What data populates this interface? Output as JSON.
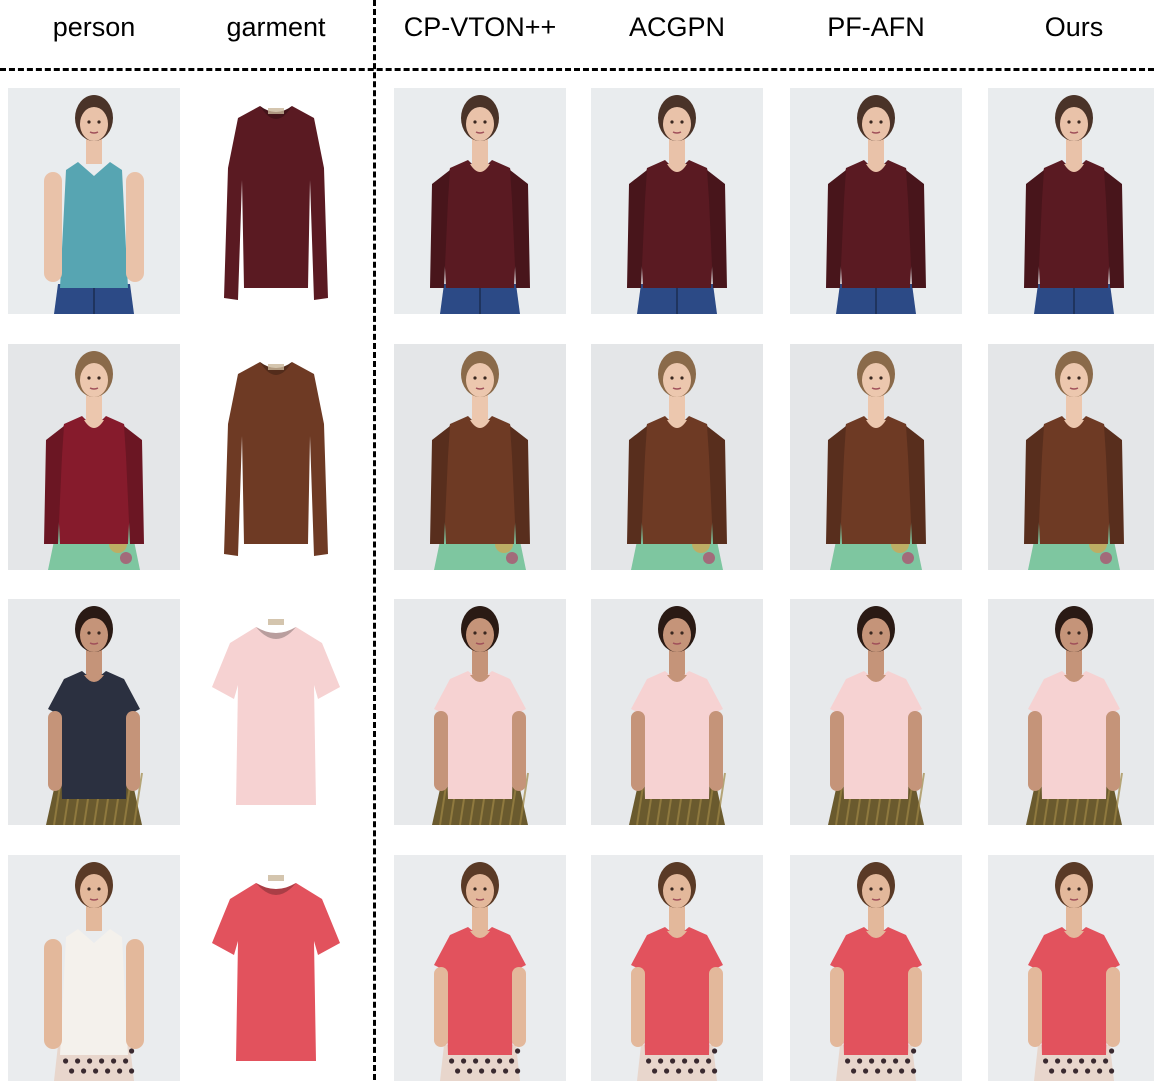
{
  "columns": [
    {
      "key": "person",
      "label": "person"
    },
    {
      "key": "garment",
      "label": "garment"
    },
    {
      "key": "cpvton",
      "label": "CP-VTON++"
    },
    {
      "key": "acgpn",
      "label": "ACGPN"
    },
    {
      "key": "pfafn",
      "label": "PF-AFN"
    },
    {
      "key": "ours",
      "label": "Ours"
    }
  ],
  "rows": [
    {
      "person": {
        "skin": "#e9c2a9",
        "hair": "#4a3328",
        "top": "#57a5b2",
        "top_style": "tank",
        "bottom": "#2c4a86",
        "bottom_style": "jeans"
      },
      "garment": {
        "color": "#5a1a22",
        "sleeve": "long"
      },
      "results": {
        "color": "#5a1a22",
        "sleeve": "long",
        "bottom": "#2c4a86",
        "bottom_style": "jeans"
      }
    },
    {
      "person": {
        "skin": "#ecc7ae",
        "hair": "#8a6a4a",
        "top": "#861b2c",
        "top_style": "long",
        "bottom": "#7ec6a0",
        "bottom_style": "skirt"
      },
      "garment": {
        "color": "#6e3a24",
        "sleeve": "long"
      },
      "results": {
        "color": "#6e3a24",
        "sleeve": "long",
        "bottom": "#7ec6a0",
        "bottom_style": "skirt"
      }
    },
    {
      "person": {
        "skin": "#c59479",
        "hair": "#2a1a14",
        "top": "#2b3040",
        "top_style": "short",
        "bottom": "#6a5a2e",
        "bottom_style": "pleated"
      },
      "garment": {
        "color": "#f6d2d2",
        "sleeve": "short"
      },
      "results": {
        "color": "#f6d2d2",
        "sleeve": "short",
        "bottom": "#6a5a2e",
        "bottom_style": "pleated"
      }
    },
    {
      "person": {
        "skin": "#e3b89b",
        "hair": "#5a3a26",
        "top": "#f4f1ec",
        "top_style": "tank",
        "bottom": "#e8d6cc",
        "bottom_style": "dots"
      },
      "garment": {
        "color": "#e2525d",
        "sleeve": "short"
      },
      "results": {
        "color": "#e2525d",
        "sleeve": "short",
        "bottom": "#e8d6cc",
        "bottom_style": "dots"
      }
    }
  ]
}
